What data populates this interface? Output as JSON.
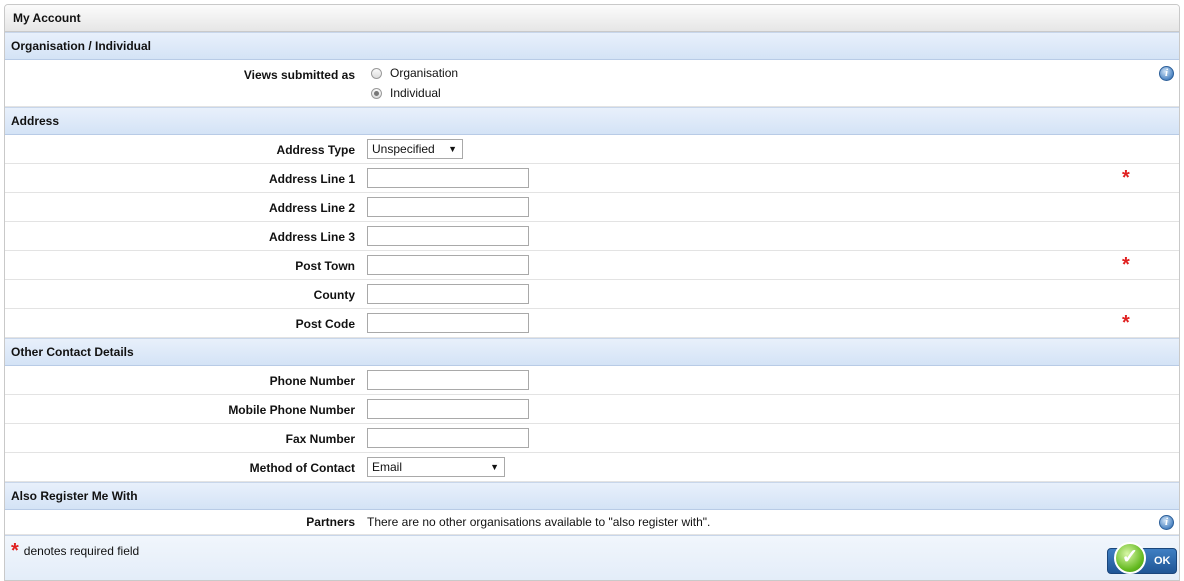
{
  "panel": {
    "title": "My Account"
  },
  "sections": {
    "organisation": {
      "title": "Organisation / Individual",
      "views_label": "Views submitted as",
      "options": [
        "Organisation",
        "Individual"
      ],
      "selected": "Individual"
    },
    "address": {
      "title": "Address",
      "type_label": "Address Type",
      "type_value": "Unspecified",
      "line1_label": "Address Line 1",
      "line2_label": "Address Line 2",
      "line3_label": "Address Line 3",
      "town_label": "Post Town",
      "county_label": "County",
      "postcode_label": "Post Code"
    },
    "contact": {
      "title": "Other Contact Details",
      "phone_label": "Phone Number",
      "mobile_label": "Mobile Phone Number",
      "fax_label": "Fax Number",
      "method_label": "Method of Contact",
      "method_value": "Email"
    },
    "register": {
      "title": "Also Register Me With",
      "partners_label": "Partners",
      "partners_text": "There are no other organisations available to \"also register with\"."
    }
  },
  "footer": {
    "required_star": "*",
    "required_note": "denotes required field",
    "ok_label": "OK"
  },
  "icons": {
    "info": "i",
    "check": "✓",
    "dropdown_arrow": "▼",
    "required": "*"
  },
  "colors": {
    "required": "#e02020",
    "section_header": "#d4e3f6",
    "ok_button": "#1f5595"
  }
}
